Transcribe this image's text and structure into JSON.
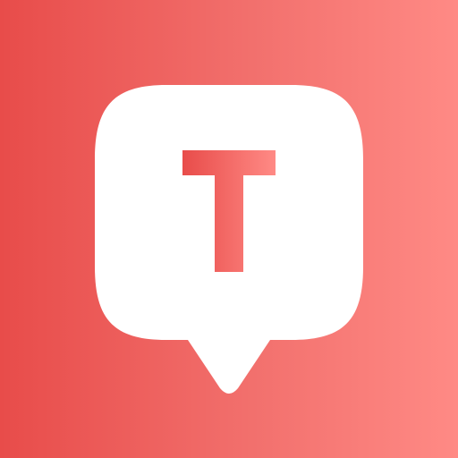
{
  "icon": {
    "name": "speech-bubble-letter-t-logo",
    "letter": "T",
    "colors": {
      "background_left": "#e84c4a",
      "background_mid": "#f2706d",
      "background_right": "#ff8a85",
      "bubble": "#ffffff",
      "letter_left": "#e84c4a",
      "letter_right": "#ff8a85"
    }
  }
}
